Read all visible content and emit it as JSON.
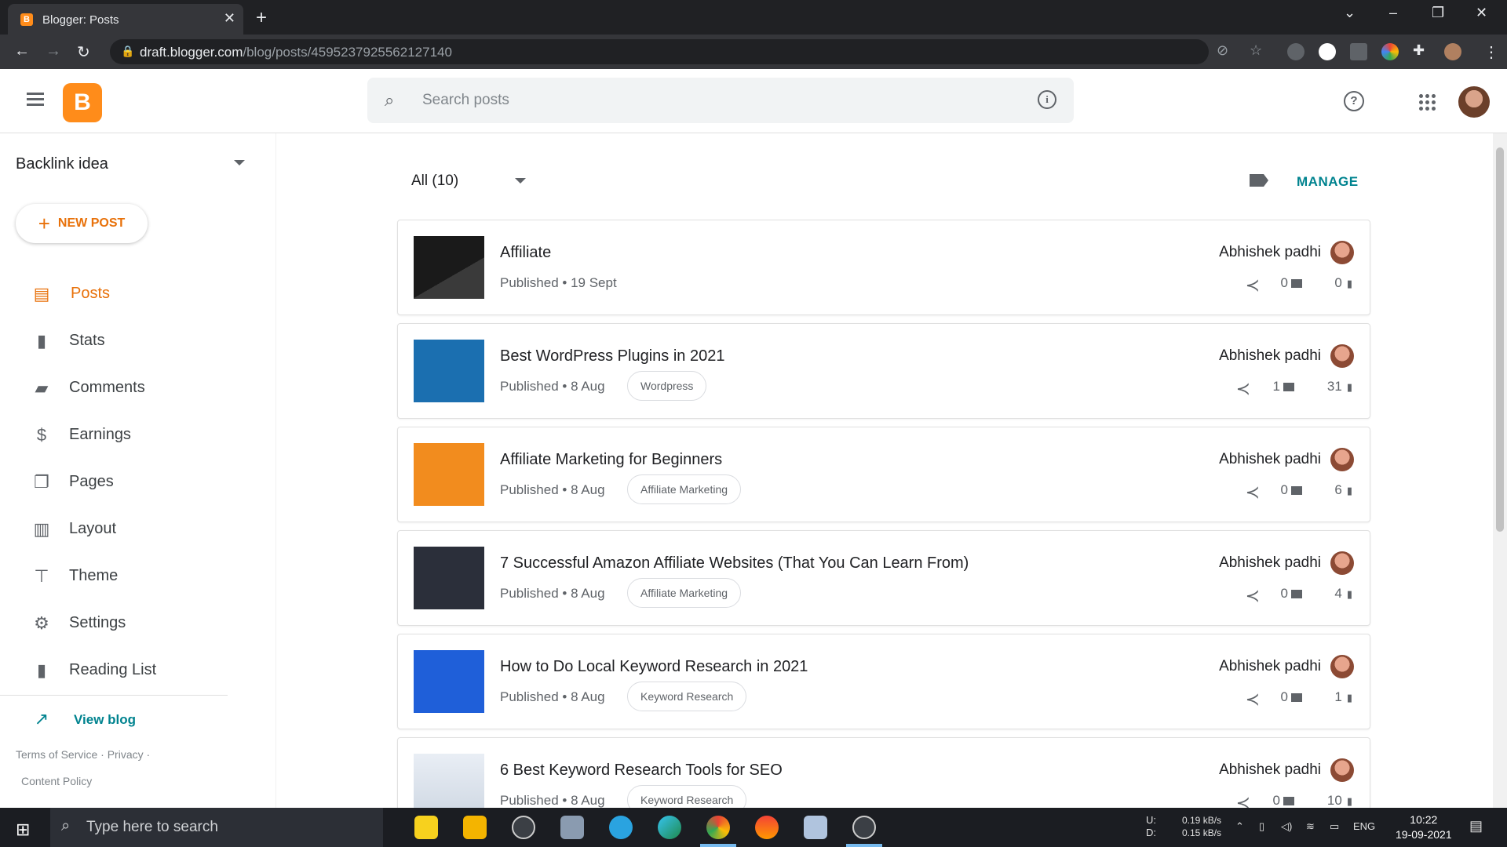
{
  "browser": {
    "tab_title": "Blogger: Posts",
    "url_host": "draft.blogger.com",
    "url_path": "/blog/posts/4595237925562127140"
  },
  "header": {
    "search_placeholder": "Search posts"
  },
  "sidebar": {
    "blog_name": "Backlink idea",
    "new_post_label": "NEW POST",
    "items": [
      {
        "label": "Posts",
        "icon": "posts-icon"
      },
      {
        "label": "Stats",
        "icon": "stats-icon"
      },
      {
        "label": "Comments",
        "icon": "comments-icon"
      },
      {
        "label": "Earnings",
        "icon": "dollar-icon"
      },
      {
        "label": "Pages",
        "icon": "pages-icon"
      },
      {
        "label": "Layout",
        "icon": "layout-icon"
      },
      {
        "label": "Theme",
        "icon": "paint-roller-icon"
      },
      {
        "label": "Settings",
        "icon": "gear-icon"
      },
      {
        "label": "Reading List",
        "icon": "bookmark-icon"
      }
    ],
    "view_blog_label": "View blog",
    "terms": "Terms of Service",
    "privacy": "Privacy",
    "content_policy": "Content Policy"
  },
  "main": {
    "filter_label": "All (10)",
    "manage_label": "MANAGE",
    "posts": [
      {
        "title": "Affiliate",
        "meta": "Published • 19 Sept",
        "label": "",
        "author": "Abhishek padhi",
        "comments": "0",
        "views": "0"
      },
      {
        "title": "Best WordPress Plugins in 2021",
        "meta": "Published • 8 Aug",
        "label": "Wordpress",
        "author": "Abhishek padhi",
        "comments": "1",
        "views": "31"
      },
      {
        "title": "Affiliate Marketing for Beginners",
        "meta": "Published • 8 Aug",
        "label": "Affiliate Marketing",
        "author": "Abhishek padhi",
        "comments": "0",
        "views": "6"
      },
      {
        "title": "7 Successful Amazon Affiliate Websites (That You Can Learn From)",
        "meta": "Published • 8 Aug",
        "label": "Affiliate Marketing",
        "author": "Abhishek padhi",
        "comments": "0",
        "views": "4"
      },
      {
        "title": "How to Do Local Keyword Research in 2021",
        "meta": "Published • 8 Aug",
        "label": "Keyword Research",
        "author": "Abhishek padhi",
        "comments": "0",
        "views": "1"
      },
      {
        "title": "6 Best Keyword Research Tools for SEO",
        "meta": "Published • 8 Aug",
        "label": "Keyword Research",
        "author": "Abhishek padhi",
        "comments": "0",
        "views": "10"
      }
    ]
  },
  "taskbar": {
    "search_placeholder": "Type here to search",
    "net_up": "0.19 kB/s",
    "net_down": "0.15 kB/s",
    "net_up_label": "U:",
    "net_down_label": "D:",
    "lang": "ENG",
    "time": "10:22",
    "date": "19-09-2021"
  },
  "colors": {
    "accent": "#e8710a",
    "manage": "#00838f",
    "blogger": "#ff8c1a"
  }
}
